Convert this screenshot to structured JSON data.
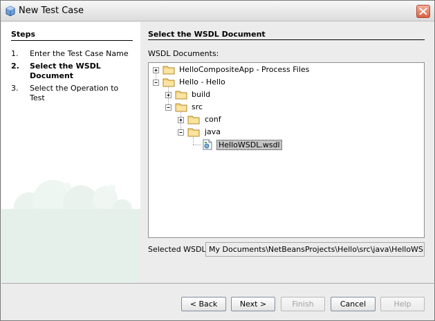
{
  "window": {
    "title": "New Test Case"
  },
  "steps": {
    "heading": "Steps",
    "items": [
      {
        "num": "1.",
        "label": "Enter the Test Case Name",
        "active": false
      },
      {
        "num": "2.",
        "label": "Select the WSDL Document",
        "active": true
      },
      {
        "num": "3.",
        "label": "Select the Operation to Test",
        "active": false
      }
    ]
  },
  "main": {
    "heading": "Select the WSDL Document",
    "docs_label": "WSDL Documents:",
    "tree": [
      {
        "label": "HelloCompositeApp - Process Files",
        "expanded": false
      },
      {
        "label": "Hello - Hello",
        "expanded": true
      },
      {
        "label": "build",
        "expanded": false
      },
      {
        "label": "src",
        "expanded": true
      },
      {
        "label": "conf",
        "expanded": false
      },
      {
        "label": "java",
        "expanded": true
      },
      {
        "label": "HelloWSDL.wsdl",
        "selected": true
      }
    ],
    "selected_label": "Selected WSDL:",
    "selected_value": "My Documents\\NetBeansProjects\\Hello\\src\\java\\HelloWSDL.wsdl"
  },
  "buttons": {
    "back": "< Back",
    "next": "Next >",
    "finish": "Finish",
    "cancel": "Cancel",
    "help": "Help"
  }
}
